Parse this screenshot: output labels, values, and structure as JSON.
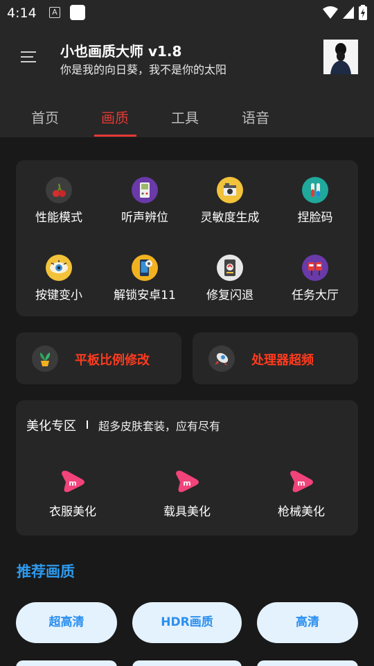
{
  "status_bar": {
    "time": "4:14",
    "notif_letter": "A"
  },
  "header": {
    "title": "小也画质大师 v1.8",
    "subtitle": "你是我的向日葵，我不是你的太阳"
  },
  "tabs": [
    {
      "label": "首页"
    },
    {
      "label": "画质"
    },
    {
      "label": "工具"
    },
    {
      "label": "语音"
    }
  ],
  "active_tab": "画质",
  "grid": [
    {
      "label": "性能模式",
      "icon": "cherry-icon",
      "color": "#3d3d3d"
    },
    {
      "label": "听声辨位",
      "icon": "gameboy-icon",
      "color": "#6a3aa8"
    },
    {
      "label": "灵敏度生成",
      "icon": "camera-icon",
      "color": "#f2c23a"
    },
    {
      "label": "捏脸码",
      "icon": "test-tube-icon",
      "color": "#1fa89b"
    },
    {
      "label": "按键变小",
      "icon": "eye-icon",
      "color": "#f2c23a"
    },
    {
      "label": "解锁安卓11",
      "icon": "phone-gear-icon",
      "color": "#f2b21f"
    },
    {
      "label": "修复闪退",
      "icon": "repair-icon",
      "color": "#e7e7e7"
    },
    {
      "label": "任务大厅",
      "icon": "mailbox-icon",
      "color": "#6a3aa8"
    }
  ],
  "wide_buttons": [
    {
      "label": "平板比例修改",
      "icon": "plant-icon"
    },
    {
      "label": "处理器超频",
      "icon": "rocket-icon"
    }
  ],
  "beauty": {
    "title": "美化专区",
    "subtitle": "超多皮肤套装，应有尽有",
    "items": [
      {
        "label": "衣服美化"
      },
      {
        "label": "载具美化"
      },
      {
        "label": "枪械美化"
      }
    ],
    "icon_color": "#f2437a"
  },
  "recommend": {
    "title": "推荐画质",
    "pills": [
      "超高清",
      "HDR画质",
      "高清"
    ]
  },
  "colors": {
    "accent": "#e53935",
    "link_blue": "#2d9bf0",
    "pill_bg": "#e4f2fd",
    "wide_label": "#ff3b1f"
  }
}
